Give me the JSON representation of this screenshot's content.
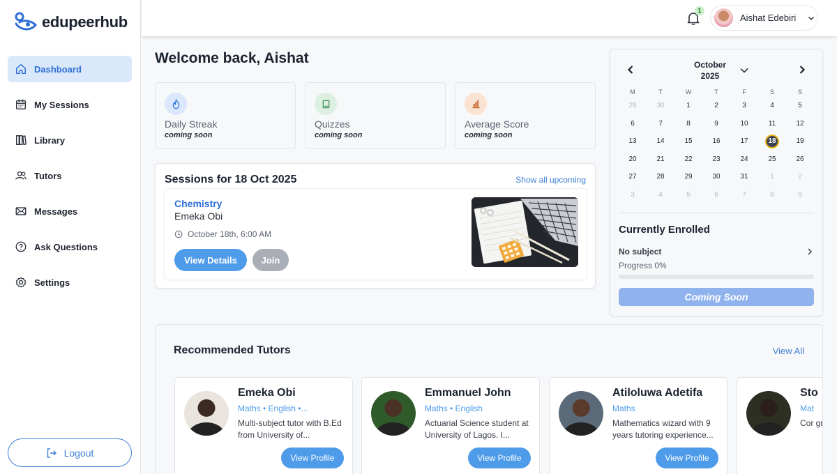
{
  "brand": {
    "name": "edupeerhub"
  },
  "sidebar": {
    "items": [
      {
        "label": "Dashboard",
        "icon": "home-icon",
        "active": true
      },
      {
        "label": "My Sessions",
        "icon": "calendar-icon"
      },
      {
        "label": "Library",
        "icon": "library-icon"
      },
      {
        "label": "Tutors",
        "icon": "users-icon"
      },
      {
        "label": "Messages",
        "icon": "mail-icon"
      },
      {
        "label": "Ask Questions",
        "icon": "help-circle-icon"
      },
      {
        "label": "Settings",
        "icon": "gear-icon"
      }
    ],
    "logout_label": "Logout"
  },
  "topbar": {
    "notification_count": "1",
    "user_name": "Aishat Edebiri"
  },
  "main": {
    "welcome": "Welcome back, Aishat",
    "stats": [
      {
        "title": "Daily Streak",
        "sub": "coming soon",
        "icon": "flame-icon",
        "color": "#dbe8fb"
      },
      {
        "title": "Quizzes",
        "sub": "coming soon",
        "icon": "book-icon",
        "color": "#dcefe0"
      },
      {
        "title": "Average Score",
        "sub": "coming soon",
        "icon": "bar-chart-icon",
        "color": "#fbe3d4"
      }
    ],
    "sessions": {
      "title": "Sessions for 18 Oct 2025",
      "show_all": "Show all upcoming",
      "session": {
        "subject": "Chemistry",
        "tutor": "Emeka Obi",
        "time": "October 18th, 6:00 AM",
        "view_label": "View Details",
        "join_label": "Join"
      }
    }
  },
  "calendar": {
    "month": "October",
    "year": "2025",
    "weekdays": [
      "M",
      "T",
      "W",
      "T",
      "F",
      "S",
      "S"
    ],
    "weeks": [
      [
        {
          "d": "29",
          "m": true
        },
        {
          "d": "30",
          "m": true
        },
        {
          "d": "1"
        },
        {
          "d": "2"
        },
        {
          "d": "3"
        },
        {
          "d": "4"
        },
        {
          "d": "5"
        }
      ],
      [
        {
          "d": "6"
        },
        {
          "d": "7"
        },
        {
          "d": "8"
        },
        {
          "d": "9"
        },
        {
          "d": "10"
        },
        {
          "d": "11"
        },
        {
          "d": "12"
        }
      ],
      [
        {
          "d": "13"
        },
        {
          "d": "14"
        },
        {
          "d": "15"
        },
        {
          "d": "16"
        },
        {
          "d": "17"
        },
        {
          "d": "18",
          "t": true
        },
        {
          "d": "19"
        }
      ],
      [
        {
          "d": "20"
        },
        {
          "d": "21"
        },
        {
          "d": "22"
        },
        {
          "d": "23"
        },
        {
          "d": "24"
        },
        {
          "d": "25"
        },
        {
          "d": "26"
        }
      ],
      [
        {
          "d": "27"
        },
        {
          "d": "28"
        },
        {
          "d": "29"
        },
        {
          "d": "30"
        },
        {
          "d": "31"
        },
        {
          "d": "1",
          "m": true
        },
        {
          "d": "2",
          "m": true
        }
      ],
      [
        {
          "d": "3",
          "m": true
        },
        {
          "d": "4",
          "m": true
        },
        {
          "d": "5",
          "m": true
        },
        {
          "d": "6",
          "m": true
        },
        {
          "d": "7",
          "m": true
        },
        {
          "d": "8",
          "m": true
        },
        {
          "d": "9",
          "m": true
        }
      ]
    ],
    "today_ring_color": "#e7b416"
  },
  "enrolled": {
    "title": "Currently Enrolled",
    "subject": "No subject",
    "progress_label": "Progress 0%",
    "progress": 0,
    "button_label": "Coming Soon"
  },
  "recommended": {
    "title": "Recommended Tutors",
    "view_all": "View All",
    "button_label": "View Profile",
    "tutors": [
      {
        "name": "Emeka Obi",
        "subjects": "Maths • English •...",
        "bio": "Multi-subject tutor with B.Ed from University of...",
        "avatar_bg": "#e9e4dd",
        "skin": "#3a2a22"
      },
      {
        "name": "Emmanuel John",
        "subjects": "Maths • English",
        "bio": "Actuarial Science student at University of Lagos. I...",
        "avatar_bg": "#2f5a2a",
        "skin": "#4a3226"
      },
      {
        "name": "Atiloluwa Adetifa",
        "subjects": "Maths",
        "bio": "Mathematics wizard with 9 years tutoring experience...",
        "avatar_bg": "#5a6a78",
        "skin": "#5a3a2a"
      },
      {
        "name": "Sto",
        "subjects": "Mat",
        "bio": "Cor gra",
        "avatar_bg": "#2c2f22",
        "skin": "#2a1f1a"
      }
    ]
  }
}
